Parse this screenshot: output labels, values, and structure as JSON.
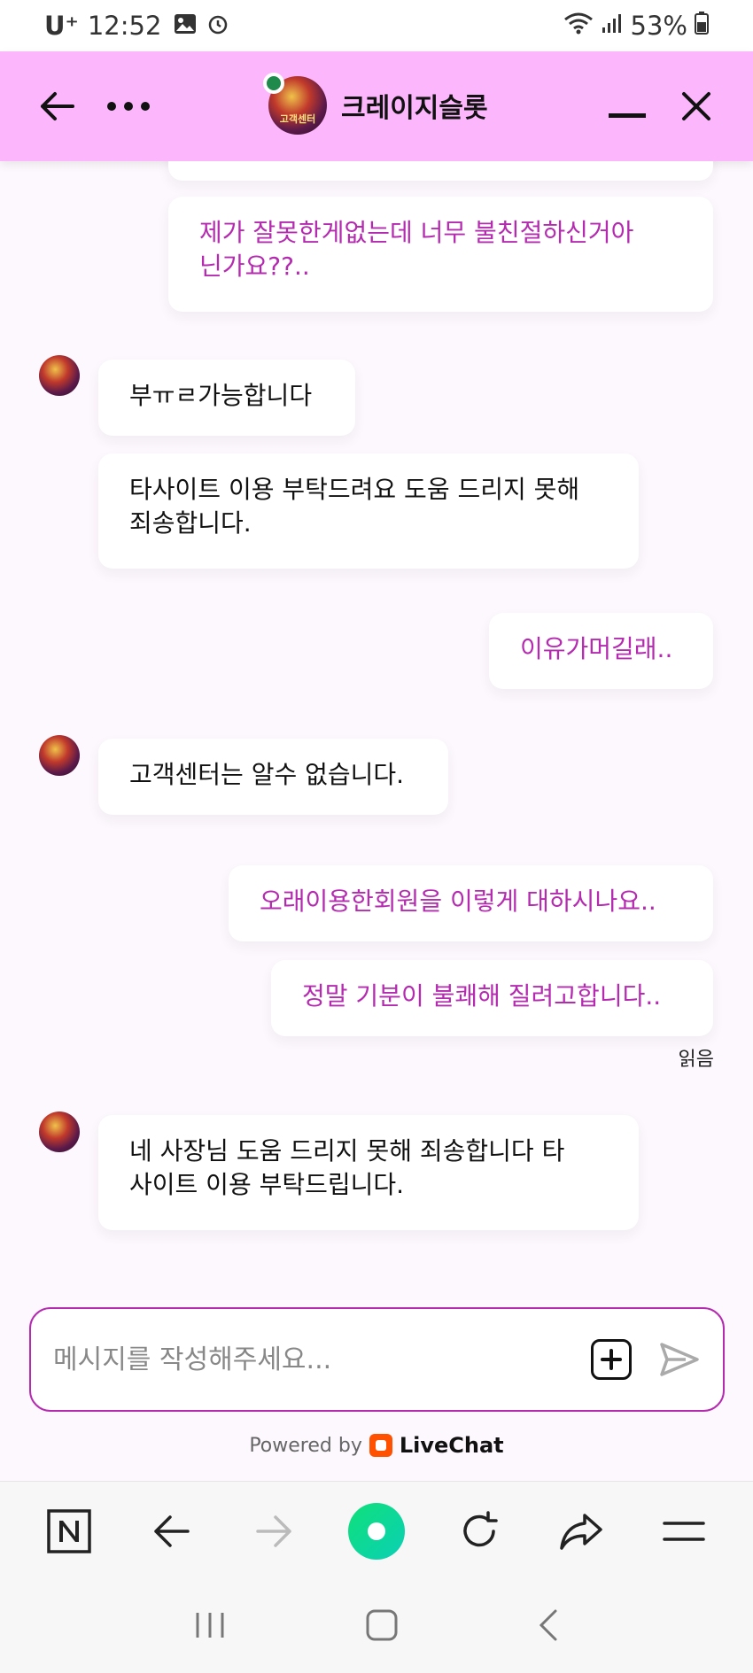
{
  "status_bar": {
    "carrier": "U⁺",
    "time": "12:52",
    "battery": "53%"
  },
  "header": {
    "title": "크레이지슬롯",
    "avatar_label": "고객센터",
    "online": true
  },
  "messages": [
    {
      "author": "visitor",
      "text": "제가 잘못한게없는데 너무 불친절하신거아\n닌가요??.."
    },
    {
      "author": "agent",
      "text": "부ㅠㄹ가능합니다"
    },
    {
      "author": "agent",
      "text": "타사이트 이용 부탁드려요 도움 드리지 못해\n죄송합니다."
    },
    {
      "author": "visitor",
      "text": "이유가머길래.."
    },
    {
      "author": "agent",
      "text": "고객센터는 알수 없습니다."
    },
    {
      "author": "visitor",
      "text": "오래이용한회원을 이렇게 대하시나요.."
    },
    {
      "author": "visitor",
      "text": "정말 기분이 불쾌해 질려고합니다.."
    },
    {
      "author": "agent",
      "text": "네 사장님 도움 드리지 못해 죄송합니다 타\n사이트 이용 부탁드립니다."
    }
  ],
  "read_receipt": "읽음",
  "composer": {
    "placeholder": "메시지를 작성해주세요..."
  },
  "powered_by": {
    "prefix": "Powered by",
    "brand": "LiveChat"
  },
  "browser_bar": {
    "icons": [
      "naver-icon",
      "back-arrow-icon",
      "forward-arrow-icon",
      "home-circle-icon",
      "refresh-icon",
      "share-icon",
      "menu-icon"
    ]
  },
  "colors": {
    "header_bg": "#fcb6fb",
    "visitor_text": "#b42bb0",
    "agent_text": "#111111",
    "accent_green": "#11d88a"
  }
}
